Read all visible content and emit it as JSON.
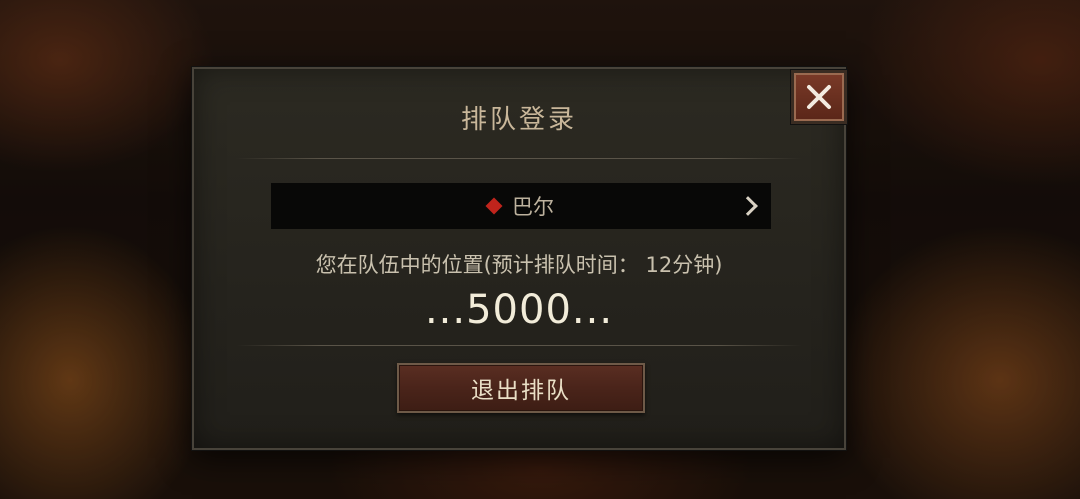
{
  "dialog": {
    "title": "排队登录",
    "server": {
      "name": "巴尔",
      "marker_color": "#c0241c"
    },
    "queue_info": "您在队伍中的位置(预计排队时间： 12分钟)",
    "queue_position": "...5000...",
    "leave_button_label": "退出排队"
  },
  "icons": {
    "close": "close-icon",
    "server_marker": "diamond-icon",
    "chevron": "chevron-right-icon"
  },
  "colors": {
    "accent_red": "#c0241c",
    "button_brown": "#4a241a"
  }
}
